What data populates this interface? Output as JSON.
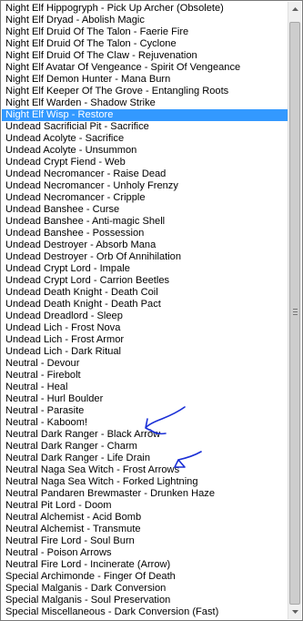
{
  "list": {
    "selected_index": 9,
    "items": [
      "Night Elf Hippogryph - Pick Up Archer (Obsolete)",
      "Night Elf Dryad - Abolish Magic",
      "Night Elf Druid Of The Talon - Faerie Fire",
      "Night Elf Druid Of The Talon - Cyclone",
      "Night Elf Druid Of The Claw - Rejuvenation",
      "Night Elf Avatar Of Vengeance - Spirit Of Vengeance",
      "Night Elf Demon Hunter - Mana Burn",
      "Night Elf Keeper Of The Grove - Entangling Roots",
      "Night Elf Warden - Shadow Strike",
      "Night Elf Wisp - Restore",
      "Undead Sacrificial Pit - Sacrifice",
      "Undead Acolyte - Sacrifice",
      "Undead Acolyte - Unsummon",
      "Undead Crypt Fiend - Web",
      "Undead Necromancer - Raise Dead",
      "Undead Necromancer - Unholy Frenzy",
      "Undead Necromancer - Cripple",
      "Undead Banshee - Curse",
      "Undead Banshee - Anti-magic Shell",
      "Undead Banshee - Possession",
      "Undead Destroyer - Absorb Mana",
      "Undead Destroyer - Orb Of Annihilation",
      "Undead Crypt Lord - Impale",
      "Undead Crypt Lord - Carrion Beetles",
      "Undead Death Knight - Death Coil",
      "Undead Death Knight - Death Pact",
      "Undead Dreadlord - Sleep",
      "Undead Lich - Frost Nova",
      "Undead Lich - Frost Armor",
      "Undead Lich - Dark Ritual",
      "Neutral - Devour",
      "Neutral - Firebolt",
      "Neutral - Heal",
      "Neutral - Hurl Boulder",
      "Neutral - Parasite",
      "Neutral - Kaboom!",
      "Neutral Dark Ranger - Black Arrow",
      "Neutral Dark Ranger - Charm",
      "Neutral Dark Ranger - Life Drain",
      "Neutral Naga Sea Witch - Frost Arrows",
      "Neutral Naga Sea Witch - Forked Lightning",
      "Neutral Pandaren Brewmaster - Drunken Haze",
      "Neutral Pit Lord - Doom",
      "Neutral Alchemist - Acid Bomb",
      "Neutral Alchemist - Transmute",
      "Neutral Fire Lord - Soul Burn",
      "Neutral - Poison Arrows",
      "Neutral Fire Lord - Incinerate (Arrow)",
      "Special Archimonde - Finger Of Death",
      "Special Malganis - Dark Conversion",
      "Special Malganis - Soul Preservation",
      "Special Miscellaneous - Dark Conversion (Fast)"
    ]
  },
  "colors": {
    "selection_bg": "#3399ff",
    "selection_fg": "#ffffff",
    "annotation_ink": "#1a2fd6"
  },
  "scrollbar": {
    "position_fraction": 1.0,
    "up_icon": "arrow-up-icon",
    "down_icon": "arrow-down-icon"
  }
}
